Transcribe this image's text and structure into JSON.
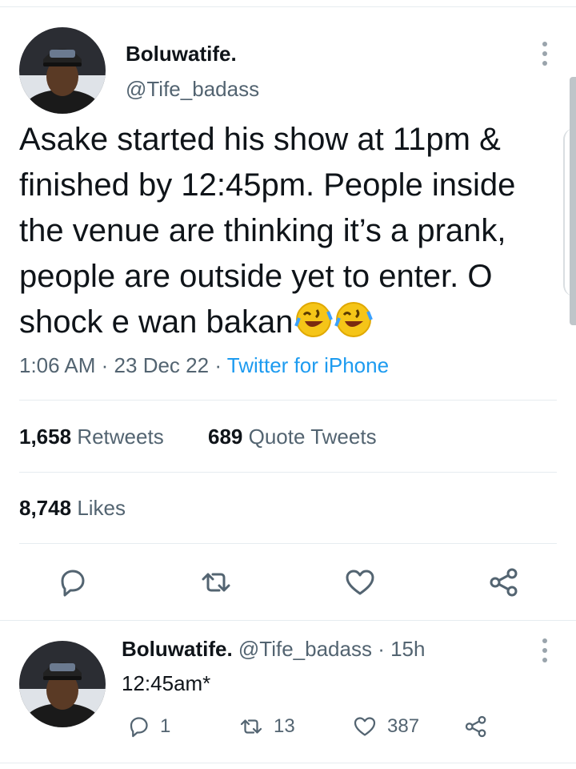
{
  "tweet": {
    "author_name": "Boluwatife.",
    "author_handle": "@Tife_badass",
    "text": "Asake started his show at 11pm & finished by 12:45pm. People inside the venue are thinking it’s a prank, people are outside yet to enter. O shock e wan bakan",
    "emojis": [
      "rolling-on-floor-laughing",
      "rolling-on-floor-laughing"
    ],
    "time": "1:06 AM",
    "date": "23 Dec 22",
    "separator": "·",
    "source": "Twitter for iPhone",
    "retweets_count": "1,658",
    "retweets_label": "Retweets",
    "quotes_count": "689",
    "quotes_label": "Quote Tweets",
    "likes_count": "8,748",
    "likes_label": "Likes"
  },
  "reply": {
    "author_name": "Boluwatife.",
    "author_handle": "@Tife_badass",
    "age": "· 15h",
    "text": "12:45am*",
    "reply_count": "1",
    "retweet_count": "13",
    "like_count": "387"
  },
  "icons": [
    "more-vertical-icon",
    "reply-icon",
    "retweet-icon",
    "like-icon",
    "share-icon"
  ],
  "colors": {
    "link": "#1d9bf0",
    "secondary_text": "#536471",
    "divider": "#e6ecf0"
  }
}
